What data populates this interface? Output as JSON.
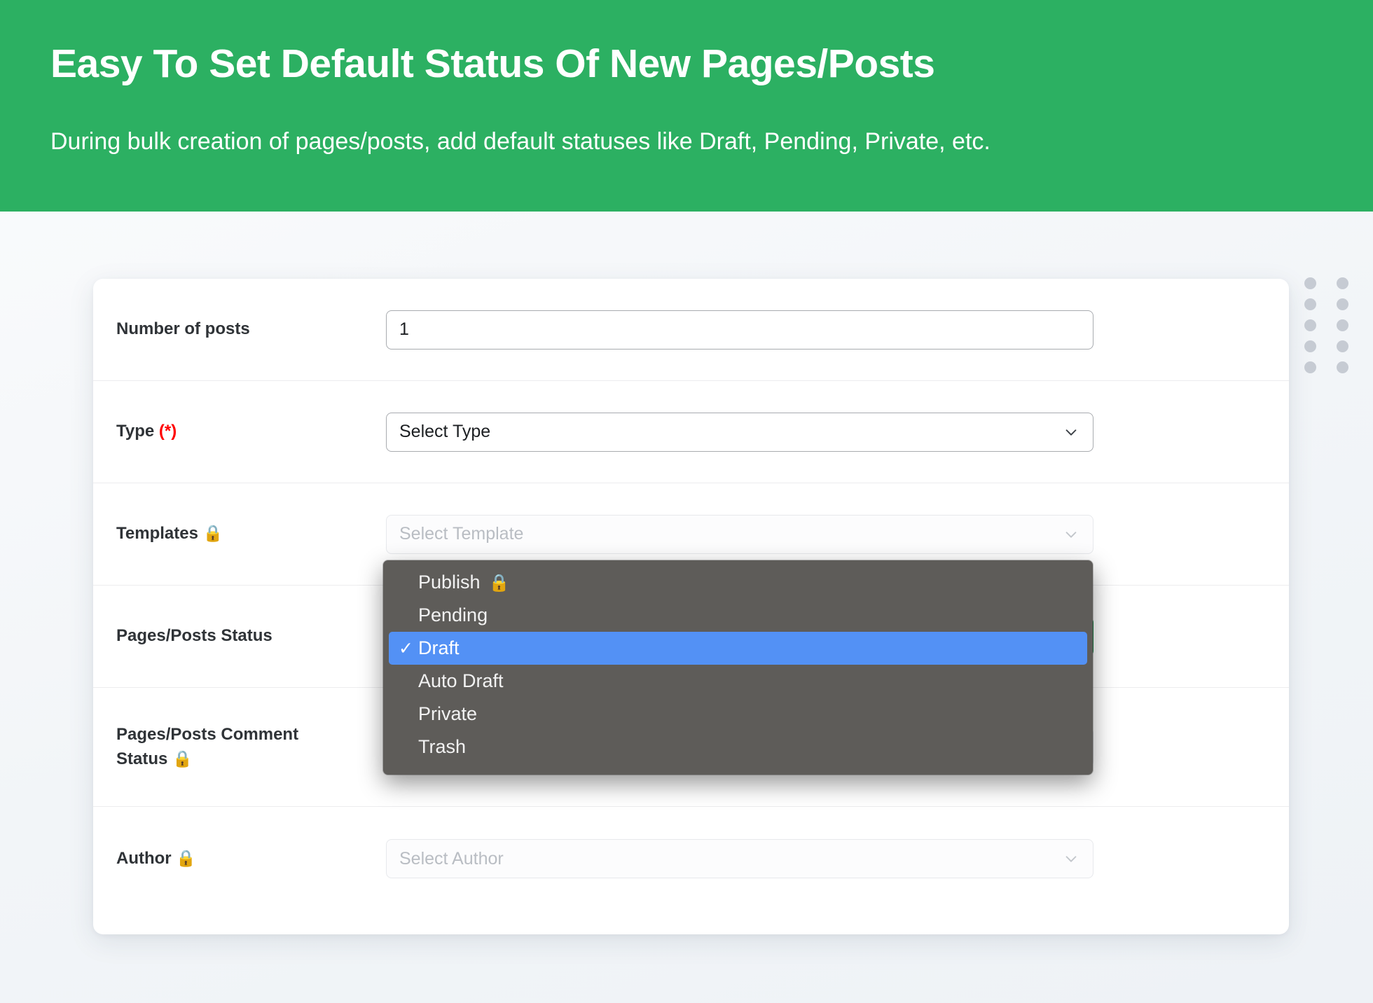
{
  "banner": {
    "title": "Easy To Set Default Status Of New Pages/Posts",
    "subtitle": "During bulk creation of pages/posts, add default statuses like Draft, Pending, Private, etc.",
    "background_color": "#2cb062",
    "text_color": "#ffffff"
  },
  "decoration": {
    "dots_icon": "dot-grid",
    "dots_color": "#c6cbd3",
    "rows": 5,
    "cols": 2
  },
  "form": {
    "rows": [
      {
        "id": "number-of-posts",
        "label": "Number of posts",
        "required_marker": "",
        "lock": "",
        "control": "text",
        "value": "1",
        "placeholder": "",
        "state": "active"
      },
      {
        "id": "type",
        "label": "Type",
        "required_marker": "(*)",
        "lock": "",
        "control": "select",
        "value": "Select Type",
        "placeholder": "Select Type",
        "state": "active",
        "chevron": "chevron-down-icon"
      },
      {
        "id": "templates",
        "label": "Templates",
        "required_marker": "",
        "lock": "🔒",
        "control": "select",
        "value": "Select Template",
        "placeholder": "Select Template",
        "state": "disabled",
        "chevron": "chevron-down-icon"
      },
      {
        "id": "pages-posts-status",
        "label": "Pages/Posts Status",
        "required_marker": "",
        "lock": "",
        "control": "select",
        "value": "Draft",
        "placeholder": "",
        "state": "focused-open",
        "chevron": "chevron-down-icon"
      },
      {
        "id": "pages-posts-comment-status",
        "label": "Pages/Posts Comment Status",
        "label_line1": "Pages/Posts Comment",
        "label_line2": "Status",
        "required_marker": "",
        "lock": "🔒",
        "control": "select",
        "value": "",
        "placeholder": "",
        "state": "disabled",
        "chevron": "chevron-down-icon"
      },
      {
        "id": "author",
        "label": "Author",
        "required_marker": "",
        "lock": "🔒",
        "control": "select",
        "value": "Select Author",
        "placeholder": "Select Author",
        "state": "disabled",
        "chevron": "chevron-down-icon"
      }
    ]
  },
  "dropdown": {
    "owner": "pages-posts-status",
    "background_color": "#5e5c59",
    "highlight_color": "#5391f5",
    "selected_value": "Draft",
    "checkmark": "✓",
    "options": [
      {
        "label": "Publish",
        "lock": "🔒",
        "selected": false
      },
      {
        "label": "Pending",
        "lock": "",
        "selected": false
      },
      {
        "label": "Draft",
        "lock": "",
        "selected": true
      },
      {
        "label": "Auto Draft",
        "lock": "",
        "selected": false
      },
      {
        "label": "Private",
        "lock": "",
        "selected": false
      },
      {
        "label": "Trash",
        "lock": "",
        "selected": false
      }
    ]
  }
}
